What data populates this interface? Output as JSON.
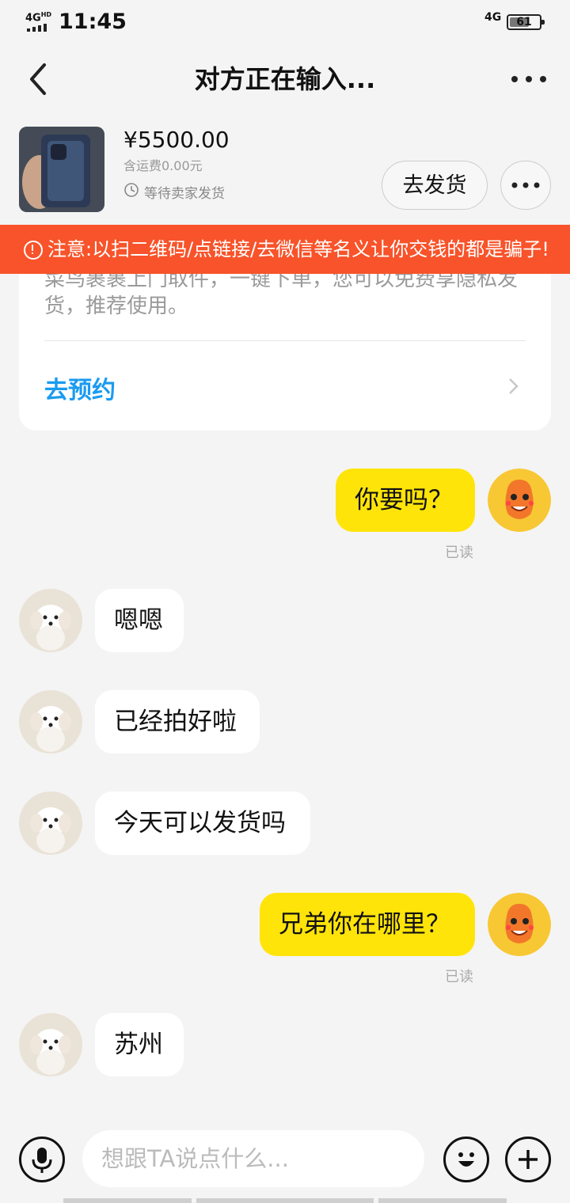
{
  "status_bar": {
    "signal_label": "4G",
    "signal_sup": "HD",
    "time": "11:45",
    "network": "4G",
    "battery": "61"
  },
  "header": {
    "title": "对方正在输入..."
  },
  "product": {
    "price": "¥5500.00",
    "shipping": "含运费0.00元",
    "status": "等待卖家发货",
    "ship_button": "去发货"
  },
  "warning": {
    "text": "注意:以扫二维码/点链接/去微信等名义让你交钱的都是骗子!"
  },
  "card": {
    "description": "菜鸟裹裹上门取件，一键下单，您可以免费享隐私发货，推荐使用。",
    "action": "去预约"
  },
  "messages": [
    {
      "from": "me",
      "text": "你要吗？",
      "read": "已读"
    },
    {
      "from": "them",
      "text": "嗯嗯"
    },
    {
      "from": "them",
      "text": "已经拍好啦"
    },
    {
      "from": "them",
      "text": "今天可以发货吗"
    },
    {
      "from": "me",
      "text": "兄弟你在哪里？",
      "read": "已读"
    },
    {
      "from": "them",
      "text": "苏州"
    }
  ],
  "composer": {
    "placeholder": "想跟TA说点什么..."
  },
  "colors": {
    "accent_yellow": "#ffe40a",
    "warning_red": "#f8532a",
    "link_blue": "#1a9bf0",
    "background": "#f4f4f4"
  },
  "icons": [
    "back-arrow-icon",
    "more-dots-icon",
    "clock-icon",
    "alert-icon",
    "chevron-right-icon",
    "microphone-icon",
    "emoji-icon",
    "plus-icon"
  ]
}
